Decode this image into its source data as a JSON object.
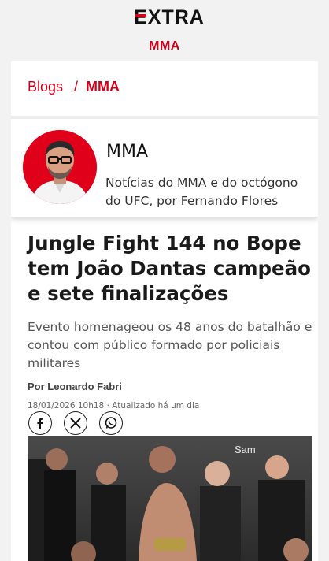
{
  "header": {
    "logo_text": "EXTRA",
    "section_label": "MMA"
  },
  "breadcrumb": {
    "items": [
      "Blogs",
      "MMA"
    ],
    "separator": "/"
  },
  "blog": {
    "title": "MMA",
    "description": "Notícias do MMA e do octógono do UFC, por Fernando Flores"
  },
  "article": {
    "headline": "Jungle Fight 144 no Bope tem João Dantas campeão e sete finalizações",
    "subtitle": "Evento homenageou os 48 anos do batalhão e contou com público formado por policiais militares",
    "byline": "Por Leonardo Fabri",
    "dateline": "18/01/2026 10h18 · Atualizado há um dia",
    "photo_partial_text": "Sam"
  },
  "share": [
    "facebook-icon",
    "x-icon",
    "whatsapp-icon"
  ],
  "colors": {
    "brand_red": "#d0021b",
    "header_bg": "#f2f2f2"
  }
}
